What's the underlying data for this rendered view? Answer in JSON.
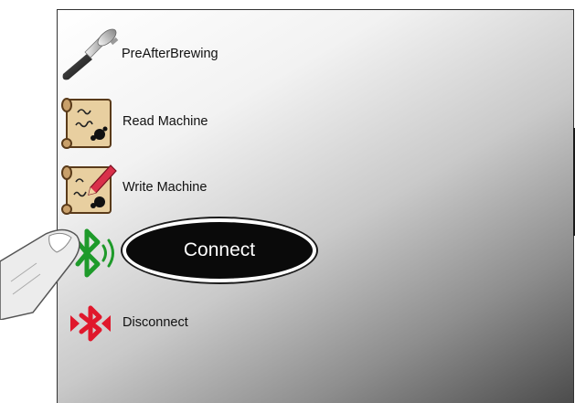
{
  "menu": {
    "items": [
      {
        "label": "PreAfterBrewing",
        "icon": "portafilter-icon"
      },
      {
        "label": "Read Machine",
        "icon": "scroll-read-icon"
      },
      {
        "label": "Write Machine",
        "icon": "scroll-write-icon"
      },
      {
        "label": "Connect",
        "icon": "bluetooth-connect-icon"
      },
      {
        "label": "Disconnect",
        "icon": "bluetooth-disconnect-icon"
      }
    ]
  },
  "colors": {
    "bluetooth_connect": "#1e9a2a",
    "bluetooth_disconnect": "#e0182c",
    "callout_bg": "#0a0a0a",
    "callout_text": "#ffffff"
  }
}
